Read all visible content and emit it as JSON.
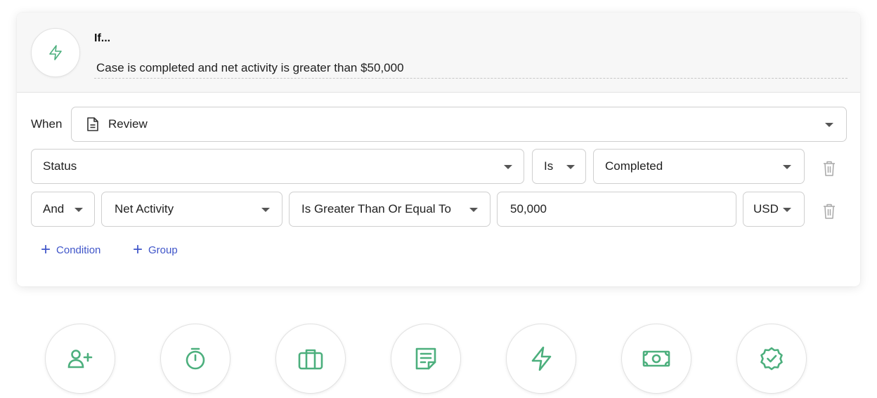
{
  "header": {
    "if_label": "If...",
    "description": "Case is completed and net activity is greater than $50,000",
    "icon": "lightning-icon"
  },
  "when": {
    "label": "When",
    "entity": "Review",
    "entity_icon": "document-icon"
  },
  "conditions": [
    {
      "field": "Status",
      "operator": "Is",
      "value": "Completed"
    },
    {
      "connector": "And",
      "field": "Net Activity",
      "operator": "Is Greater Than Or Equal To",
      "value": "50,000",
      "currency": "USD"
    }
  ],
  "actions_bar": {
    "add_condition": "Condition",
    "add_group": "Group"
  },
  "action_icons": [
    "add-user-icon",
    "stopwatch-icon",
    "briefcase-icon",
    "note-icon",
    "lightning-icon",
    "money-icon",
    "verified-badge-icon"
  ],
  "colors": {
    "accent_green": "#4caf7d",
    "link_blue": "#3f55c9"
  }
}
